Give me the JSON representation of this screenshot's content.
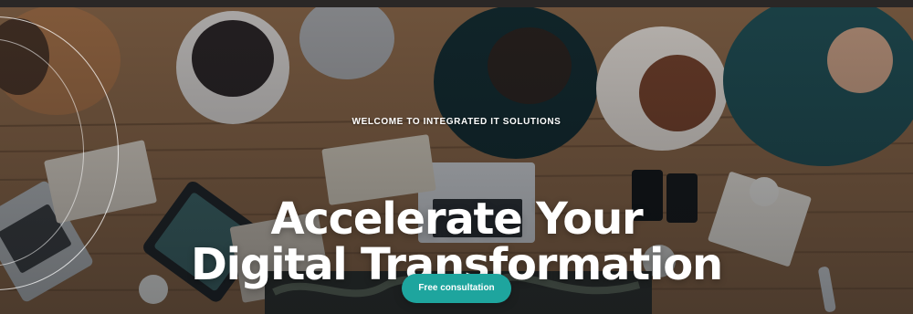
{
  "hero": {
    "eyebrow": "WELCOME TO INTEGRATED IT SOLUTIONS",
    "headline": {
      "line1": "Accelerate Your",
      "line2": "Digital Transformation"
    },
    "cta_label": "Free consultation"
  },
  "colors": {
    "accent": "#1ea59e",
    "text": "#ffffff",
    "top_strip": "#2a2726"
  },
  "background_image": "team-working-at-table-photo"
}
